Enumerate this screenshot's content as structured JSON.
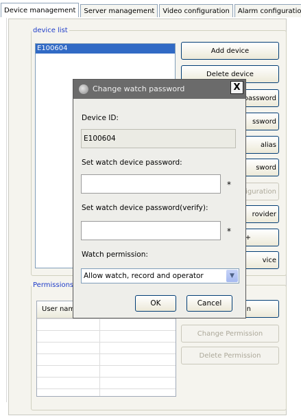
{
  "tabs": [
    {
      "label": "Device management"
    },
    {
      "label": "Server management"
    },
    {
      "label": "Video configuration"
    },
    {
      "label": "Alarm configuration"
    }
  ],
  "device_list": {
    "legend": "device list",
    "items": [
      "E100604"
    ]
  },
  "buttons": {
    "add_device": "Add device",
    "delete_device": "Delete device",
    "change_password": "password",
    "password2": "ssword",
    "alias": "alias",
    "word": "sword",
    "configuration": "nfiguration",
    "provider": "rovider",
    "plus": "+",
    "vice": "vice"
  },
  "permissions": {
    "legend": "Permissions",
    "columns": [
      "User nam"
    ],
    "add_visible": "n",
    "change": "Change Permission",
    "delete": "Delete Permission"
  },
  "dialog": {
    "title": "Change watch password",
    "close_label": "X",
    "device_id_label": "Device ID:",
    "device_id_value": "E100604",
    "password_label": "Set watch device password:",
    "password_value": "",
    "verify_label": "Set watch device password(verify):",
    "verify_value": "",
    "required_mark": "*",
    "permission_label": "Watch permission:",
    "permission_value": "Allow watch, record and operator",
    "ok": "OK",
    "cancel": "Cancel"
  },
  "colors": {
    "legend_text": "#1e3cc8",
    "selection": "#316ac5",
    "titlebar": "#6b6b6b"
  }
}
